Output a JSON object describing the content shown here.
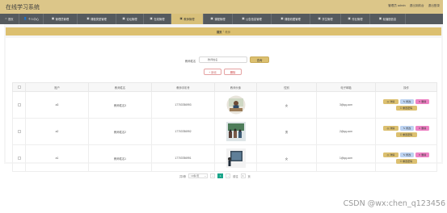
{
  "header": {
    "title": "在线学习系统",
    "links": [
      "管理员 admin",
      "退出到前台",
      "退出登录"
    ]
  },
  "nav": [
    {
      "label": "首页",
      "icon": "home-icon",
      "glyph": "⌂",
      "active": false
    },
    {
      "label": "个人中心",
      "icon": "user-icon",
      "glyph": "👤",
      "active": false
    },
    {
      "label": "管理员管理",
      "icon": "admin-icon",
      "glyph": "▣",
      "active": false
    },
    {
      "label": "课程类型管理",
      "icon": "category-icon",
      "glyph": "▣",
      "active": false
    },
    {
      "label": "论坛管理",
      "icon": "forum-icon",
      "glyph": "▣",
      "active": false
    },
    {
      "label": "在线管理",
      "icon": "online-icon",
      "glyph": "▣",
      "active": false
    },
    {
      "label": "教师管理",
      "icon": "teacher-icon",
      "glyph": "▣",
      "active": true
    },
    {
      "label": "课程管理",
      "icon": "course-icon",
      "glyph": "▣",
      "active": false
    },
    {
      "label": "公告信息管理",
      "icon": "notice-icon",
      "glyph": "▣",
      "active": false
    },
    {
      "label": "课程收藏管理",
      "icon": "favorite-icon",
      "glyph": "▣",
      "active": false
    },
    {
      "label": "学生管理",
      "icon": "student-icon",
      "glyph": "▣",
      "active": false
    },
    {
      "label": "作业管理",
      "icon": "homework-icon",
      "glyph": "▣",
      "active": false
    },
    {
      "label": "轮播图信息",
      "icon": "carousel-icon",
      "glyph": "▣",
      "active": false
    }
  ],
  "breadcrumb": {
    "home": "首页",
    "sep": "/",
    "current": "教师"
  },
  "search": {
    "label": "教师姓名",
    "placeholder": "教师姓名",
    "button": "查询"
  },
  "actions": {
    "add": "+ 新增",
    "delete": "删除"
  },
  "table": {
    "headers": [
      "",
      "账户",
      "教师姓名",
      "教师手机号",
      "教师头像",
      "性别",
      "电子邮箱",
      "操作"
    ],
    "rows": [
      {
        "account": "a3",
        "name": "教师姓名3",
        "phone": "17703786993",
        "gender": "女",
        "email": "3@qq.com"
      },
      {
        "account": "a2",
        "name": "教师姓名2",
        "phone": "17703786992",
        "gender": "男",
        "email": "2@qq.com"
      },
      {
        "account": "a1",
        "name": "教师姓名1",
        "phone": "17703786991",
        "gender": "女",
        "email": "1@qq.com"
      }
    ],
    "ops": {
      "detail": "详情",
      "edit": "修改",
      "delete": "删除",
      "reset": "重置密码"
    }
  },
  "pagination": {
    "total": "共3条",
    "page_size": "10条/页",
    "current": "1",
    "goto_label": "前往",
    "goto_value": "1",
    "page_unit": "页"
  },
  "watermark": "CSDN @wx:chen_q123456"
}
